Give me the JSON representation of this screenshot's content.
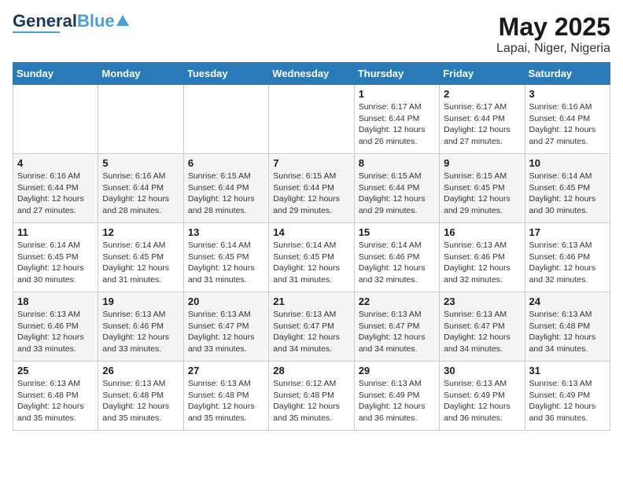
{
  "logo": {
    "text_general": "General",
    "text_blue": "Blue"
  },
  "title": "May 2025",
  "subtitle": "Lapai, Niger, Nigeria",
  "days_header": [
    "Sunday",
    "Monday",
    "Tuesday",
    "Wednesday",
    "Thursday",
    "Friday",
    "Saturday"
  ],
  "weeks": [
    [
      {
        "day": "",
        "info": ""
      },
      {
        "day": "",
        "info": ""
      },
      {
        "day": "",
        "info": ""
      },
      {
        "day": "",
        "info": ""
      },
      {
        "day": "1",
        "info": "Sunrise: 6:17 AM\nSunset: 6:44 PM\nDaylight: 12 hours and 26 minutes."
      },
      {
        "day": "2",
        "info": "Sunrise: 6:17 AM\nSunset: 6:44 PM\nDaylight: 12 hours and 27 minutes."
      },
      {
        "day": "3",
        "info": "Sunrise: 6:16 AM\nSunset: 6:44 PM\nDaylight: 12 hours and 27 minutes."
      }
    ],
    [
      {
        "day": "4",
        "info": "Sunrise: 6:16 AM\nSunset: 6:44 PM\nDaylight: 12 hours and 27 minutes."
      },
      {
        "day": "5",
        "info": "Sunrise: 6:16 AM\nSunset: 6:44 PM\nDaylight: 12 hours and 28 minutes."
      },
      {
        "day": "6",
        "info": "Sunrise: 6:15 AM\nSunset: 6:44 PM\nDaylight: 12 hours and 28 minutes."
      },
      {
        "day": "7",
        "info": "Sunrise: 6:15 AM\nSunset: 6:44 PM\nDaylight: 12 hours and 29 minutes."
      },
      {
        "day": "8",
        "info": "Sunrise: 6:15 AM\nSunset: 6:44 PM\nDaylight: 12 hours and 29 minutes."
      },
      {
        "day": "9",
        "info": "Sunrise: 6:15 AM\nSunset: 6:45 PM\nDaylight: 12 hours and 29 minutes."
      },
      {
        "day": "10",
        "info": "Sunrise: 6:14 AM\nSunset: 6:45 PM\nDaylight: 12 hours and 30 minutes."
      }
    ],
    [
      {
        "day": "11",
        "info": "Sunrise: 6:14 AM\nSunset: 6:45 PM\nDaylight: 12 hours and 30 minutes."
      },
      {
        "day": "12",
        "info": "Sunrise: 6:14 AM\nSunset: 6:45 PM\nDaylight: 12 hours and 31 minutes."
      },
      {
        "day": "13",
        "info": "Sunrise: 6:14 AM\nSunset: 6:45 PM\nDaylight: 12 hours and 31 minutes."
      },
      {
        "day": "14",
        "info": "Sunrise: 6:14 AM\nSunset: 6:45 PM\nDaylight: 12 hours and 31 minutes."
      },
      {
        "day": "15",
        "info": "Sunrise: 6:14 AM\nSunset: 6:46 PM\nDaylight: 12 hours and 32 minutes."
      },
      {
        "day": "16",
        "info": "Sunrise: 6:13 AM\nSunset: 6:46 PM\nDaylight: 12 hours and 32 minutes."
      },
      {
        "day": "17",
        "info": "Sunrise: 6:13 AM\nSunset: 6:46 PM\nDaylight: 12 hours and 32 minutes."
      }
    ],
    [
      {
        "day": "18",
        "info": "Sunrise: 6:13 AM\nSunset: 6:46 PM\nDaylight: 12 hours and 33 minutes."
      },
      {
        "day": "19",
        "info": "Sunrise: 6:13 AM\nSunset: 6:46 PM\nDaylight: 12 hours and 33 minutes."
      },
      {
        "day": "20",
        "info": "Sunrise: 6:13 AM\nSunset: 6:47 PM\nDaylight: 12 hours and 33 minutes."
      },
      {
        "day": "21",
        "info": "Sunrise: 6:13 AM\nSunset: 6:47 PM\nDaylight: 12 hours and 34 minutes."
      },
      {
        "day": "22",
        "info": "Sunrise: 6:13 AM\nSunset: 6:47 PM\nDaylight: 12 hours and 34 minutes."
      },
      {
        "day": "23",
        "info": "Sunrise: 6:13 AM\nSunset: 6:47 PM\nDaylight: 12 hours and 34 minutes."
      },
      {
        "day": "24",
        "info": "Sunrise: 6:13 AM\nSunset: 6:48 PM\nDaylight: 12 hours and 34 minutes."
      }
    ],
    [
      {
        "day": "25",
        "info": "Sunrise: 6:13 AM\nSunset: 6:48 PM\nDaylight: 12 hours and 35 minutes."
      },
      {
        "day": "26",
        "info": "Sunrise: 6:13 AM\nSunset: 6:48 PM\nDaylight: 12 hours and 35 minutes."
      },
      {
        "day": "27",
        "info": "Sunrise: 6:13 AM\nSunset: 6:48 PM\nDaylight: 12 hours and 35 minutes."
      },
      {
        "day": "28",
        "info": "Sunrise: 6:12 AM\nSunset: 6:48 PM\nDaylight: 12 hours and 35 minutes."
      },
      {
        "day": "29",
        "info": "Sunrise: 6:13 AM\nSunset: 6:49 PM\nDaylight: 12 hours and 36 minutes."
      },
      {
        "day": "30",
        "info": "Sunrise: 6:13 AM\nSunset: 6:49 PM\nDaylight: 12 hours and 36 minutes."
      },
      {
        "day": "31",
        "info": "Sunrise: 6:13 AM\nSunset: 6:49 PM\nDaylight: 12 hours and 36 minutes."
      }
    ]
  ]
}
